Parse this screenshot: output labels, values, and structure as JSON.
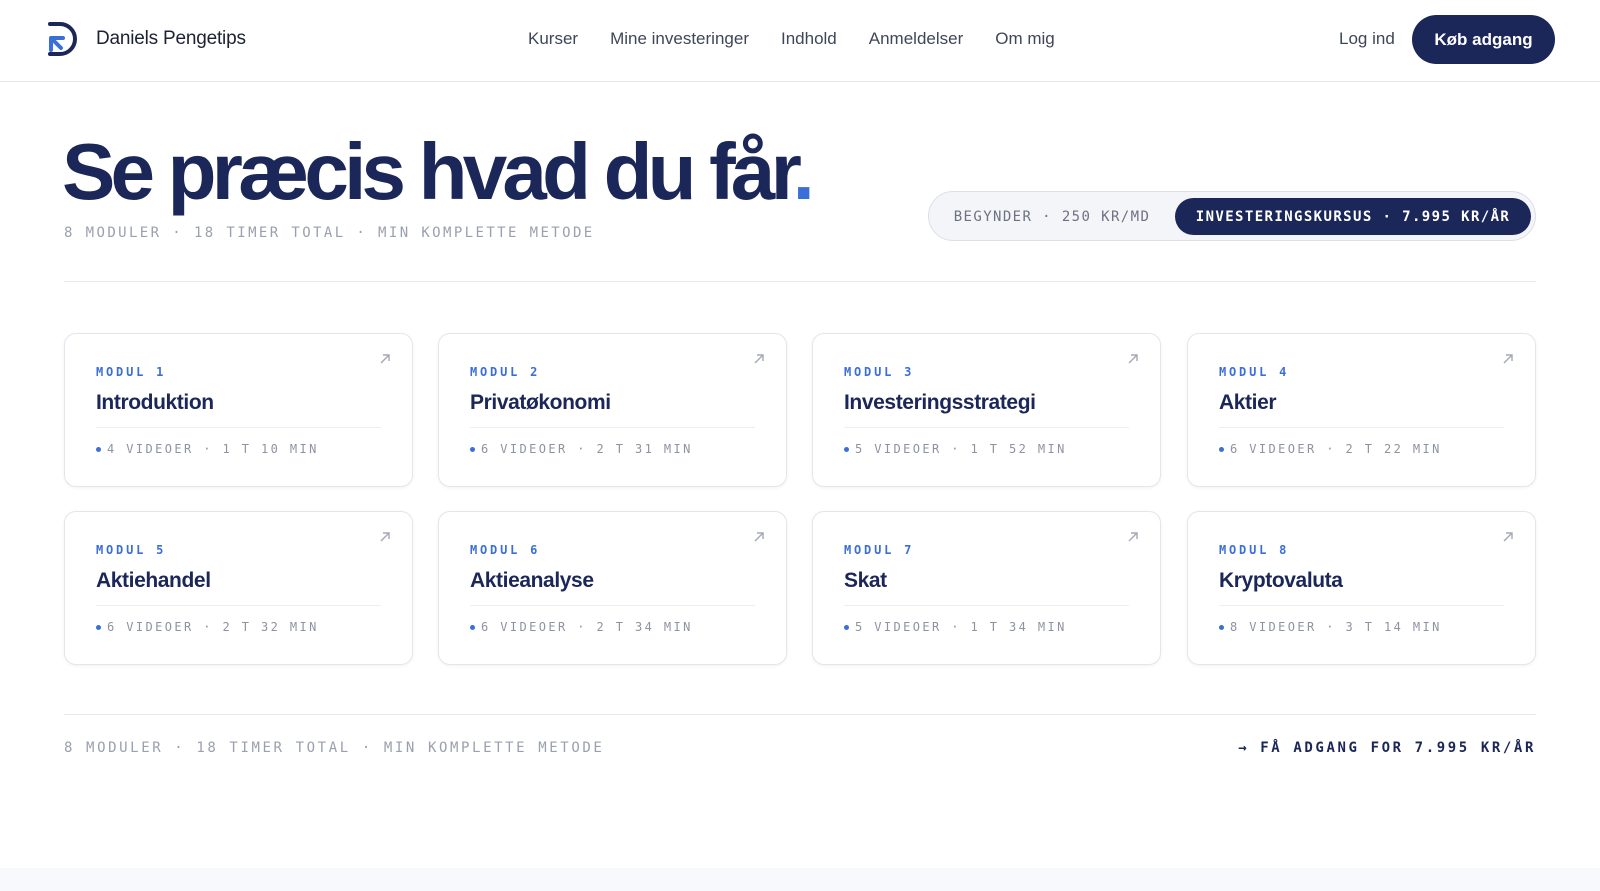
{
  "nav": {
    "brand": "Daniels Pengetips",
    "menu": [
      "Kurser",
      "Mine investeringer",
      "Indhold",
      "Anmeldelser",
      "Om mig"
    ],
    "login": "Log ind",
    "cta": "Køb adgang"
  },
  "hero": {
    "title": "Se præcis hvad du får",
    "title_dot": ".",
    "subtitle": "8 MODULER · 18 TIMER TOTAL · MIN KOMPLETTE METODE",
    "toggle": {
      "option1": "BEGYNDER · 250 KR/MD",
      "option2": "INVESTERINGSKURSUS · 7.995 KR/ÅR",
      "selected": "option2"
    }
  },
  "modules": [
    {
      "label": "MODUL 1",
      "name": "Introduktion",
      "meta": "4 VIDEOER · 1 T 10 MIN"
    },
    {
      "label": "MODUL 2",
      "name": "Privatøkonomi",
      "meta": "6 VIDEOER · 2 T 31 MIN"
    },
    {
      "label": "MODUL 3",
      "name": "Investeringsstrategi",
      "meta": "5 VIDEOER · 1 T 52 MIN"
    },
    {
      "label": "MODUL 4",
      "name": "Aktier",
      "meta": "6 VIDEOER · 2 T 22 MIN"
    },
    {
      "label": "MODUL 5",
      "name": "Aktiehandel",
      "meta": "6 VIDEOER · 2 T 32 MIN"
    },
    {
      "label": "MODUL 6",
      "name": "Aktieanalyse",
      "meta": "6 VIDEOER · 2 T 34 MIN"
    },
    {
      "label": "MODUL 7",
      "name": "Skat",
      "meta": "5 VIDEOER · 1 T 34 MIN"
    },
    {
      "label": "MODUL 8",
      "name": "Kryptovaluta",
      "meta": "8 VIDEOER · 3 T 14 MIN"
    }
  ],
  "footer": {
    "left": "8 MODULER · 18 TIMER TOTAL · MIN KOMPLETTE METODE",
    "right": "→ FÅ ADGANG FOR 7.995 KR/ÅR"
  },
  "colors": {
    "navy": "#1b2659",
    "accent": "#3b6fd8",
    "muted": "#9aa0ad"
  },
  "icons": {
    "logo": "brand-logo-icon",
    "card_arrow": "arrow-up-right-icon"
  }
}
